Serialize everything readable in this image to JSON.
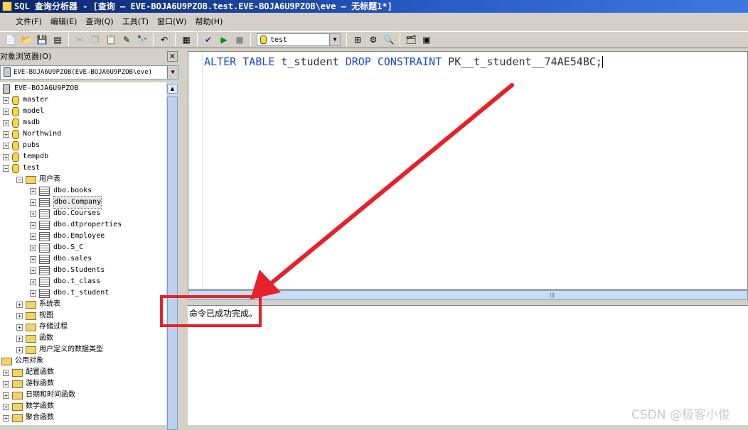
{
  "window": {
    "title": "SQL 查询分析器 - [查询 — EVE-BOJA6U9PZOB.test.EVE-BOJA6U9PZOB\\eve — 无标题1*]"
  },
  "menu": [
    "文件(F)",
    "编辑(E)",
    "查询(Q)",
    "工具(T)",
    "窗口(W)",
    "帮助(H)"
  ],
  "toolbar": {
    "database": "test"
  },
  "object_browser": {
    "title": "对象浏览器(O)",
    "close": "✕",
    "server_combo": "EVE-BOJA6U9PZOB(EVE-BOJA6U9PZOB\\eve)",
    "server_node": "EVE-BOJA6U9PZOB",
    "databases": [
      "master",
      "model",
      "msdb",
      "Northwind",
      "pubs",
      "tempdb",
      "test"
    ],
    "user_tables_label": "用户表",
    "tables": [
      "dbo.books",
      "dbo.Company",
      "dbo.Courses",
      "dbo.dtproperties",
      "dbo.Employee",
      "dbo.S_C",
      "dbo.sales",
      "dbo.Students",
      "dbo.t_class",
      "dbo.t_student"
    ],
    "test_children": [
      "系统表",
      "视图",
      "存储过程",
      "函数",
      "用户定义的数据类型"
    ],
    "public_objects_label": "公用对象",
    "public_children": [
      "配置函数",
      "游标函数",
      "日期和时间函数",
      "数学函数",
      "聚合函数"
    ]
  },
  "editor": {
    "kw1": "ALTER TABLE",
    "t1": " t_student ",
    "kw2": "DROP CONSTRAINT",
    "t2": " PK__t_student__74AE54BC;"
  },
  "results": {
    "message": "命令已成功完成。"
  },
  "colors": {
    "highlight": "#e8202a",
    "keyword": "#1e49d6"
  },
  "watermark": "CSDN @极客小俊"
}
